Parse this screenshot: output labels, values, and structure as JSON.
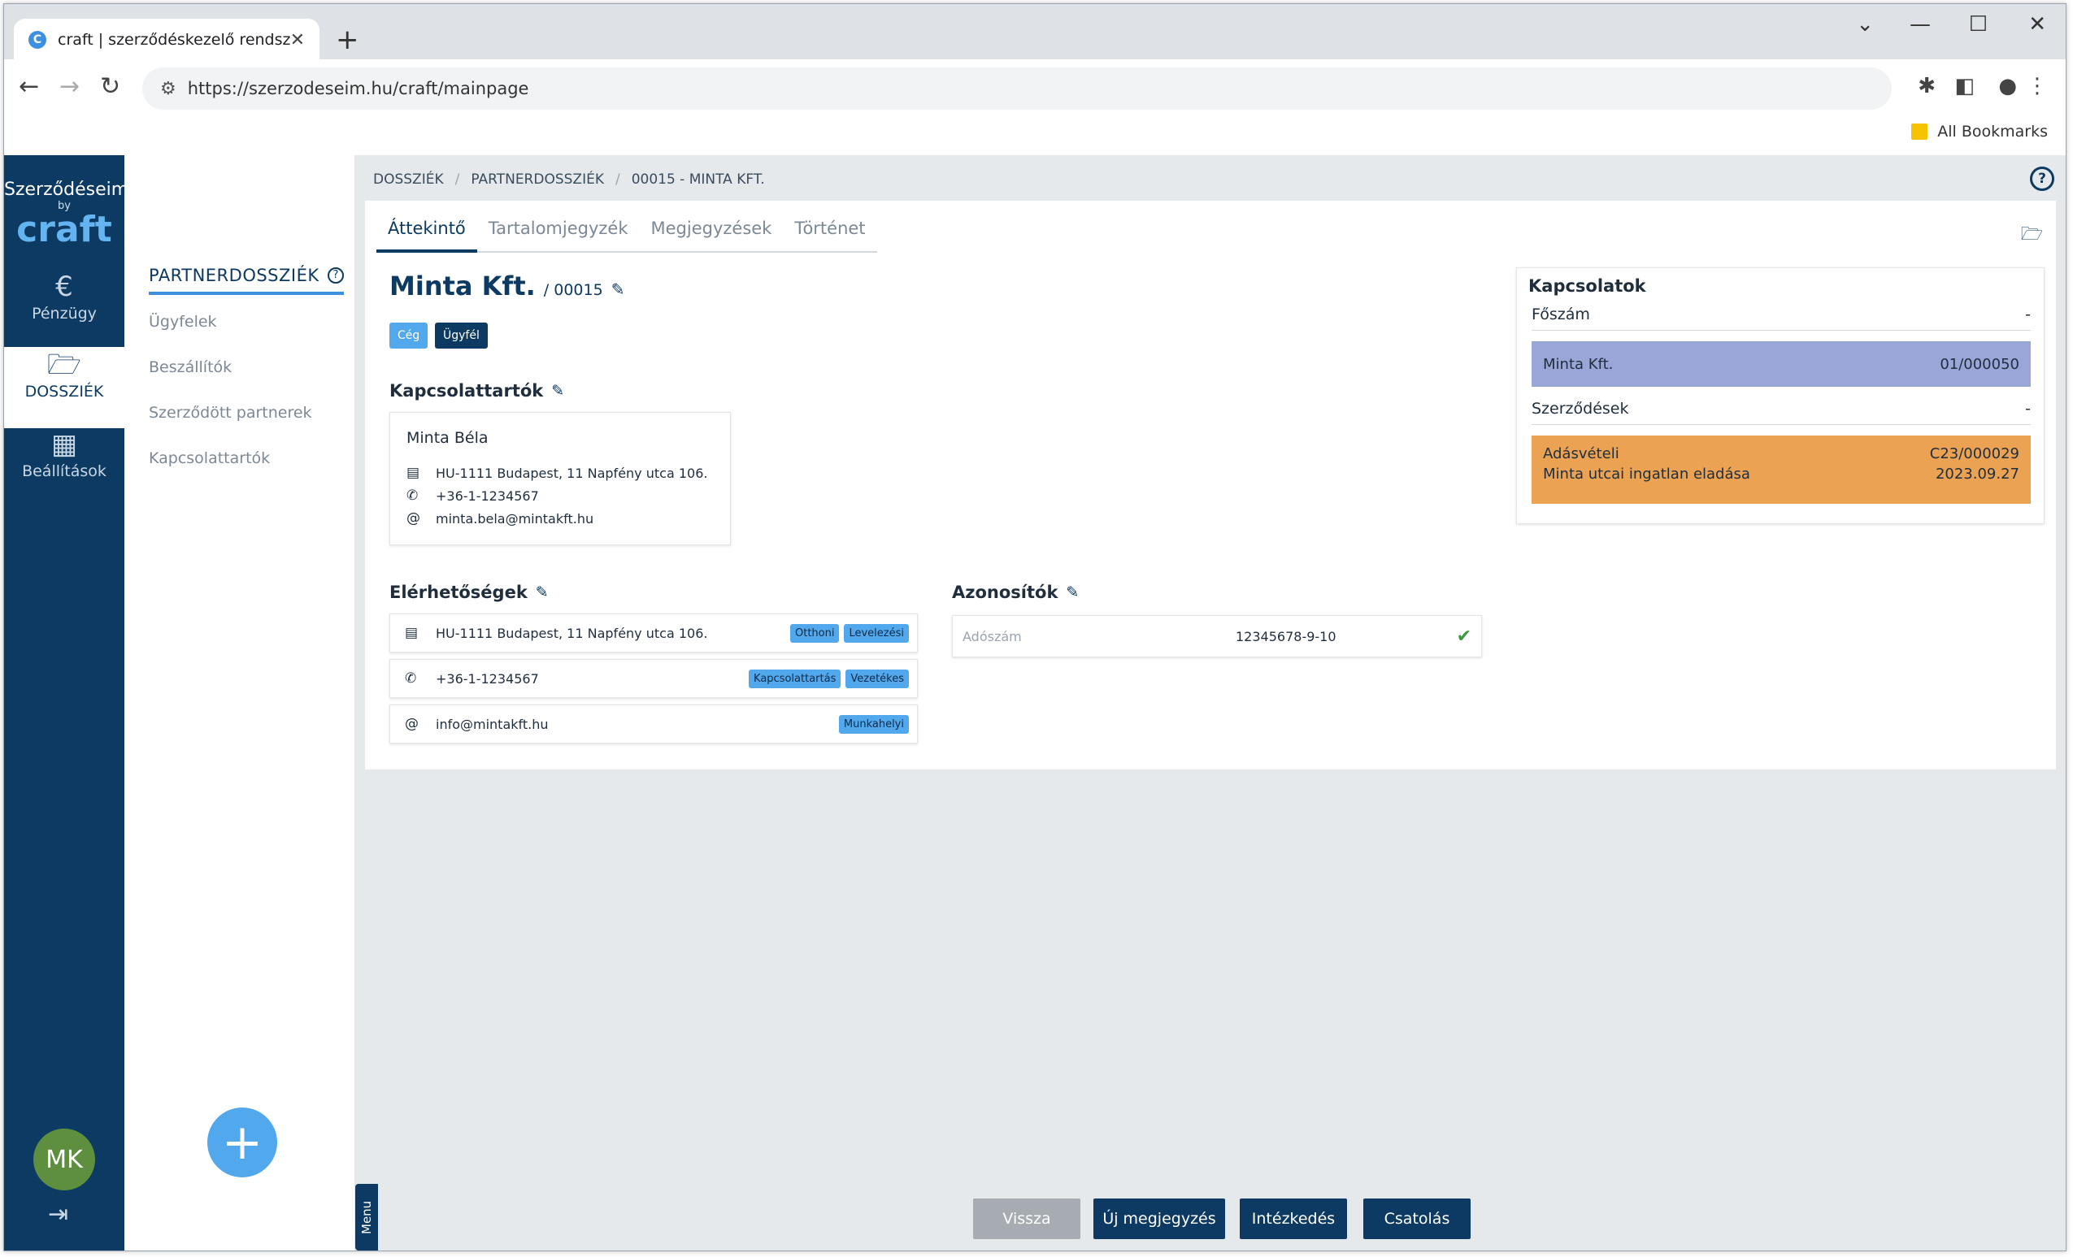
{
  "browser": {
    "tab_title": "craft | szerződéskezelő rendszer",
    "tab_favicon": "C",
    "url": "https://szerzodeseim.hu/craft/mainpage",
    "bookmarks_label": "All Bookmarks"
  },
  "brand": {
    "line1": "Szerződéseim",
    "line2": "by",
    "line3": "craft"
  },
  "rail": {
    "items": [
      {
        "label": "Pénzügy",
        "icon": "euro-icon"
      },
      {
        "label": "DOSSZIÉK",
        "icon": "folder-open-icon"
      },
      {
        "label": "Beállítások",
        "icon": "building-icon"
      }
    ],
    "avatar_initials": "MK"
  },
  "sub": {
    "title": "PARTNERDOSSZIÉK",
    "items": [
      "Ügyfelek",
      "Beszállítók",
      "Szerződött partnerek",
      "Kapcsolattartók"
    ]
  },
  "breadcrumb": [
    "DOSSZIÉK",
    "PARTNERDOSSZIÉK",
    "00015 - MINTA KFT."
  ],
  "tabs": [
    "Áttekintő",
    "Tartalomjegyzék",
    "Megjegyzések",
    "Történet"
  ],
  "company": {
    "name": "Minta Kft.",
    "id": "/ 00015",
    "badges": [
      "Cég",
      "Ügyfél"
    ]
  },
  "kapcsolattartok": {
    "title": "Kapcsolattartók",
    "contact": {
      "name": "Minta Béla",
      "address": "HU-1111 Budapest, 11 Napfény utca 106.",
      "phone": "+36-1-1234567",
      "email": "minta.bela@mintakft.hu"
    }
  },
  "elerhetosegek": {
    "title": "Elérhetőségek",
    "rows": [
      {
        "text": "HU-1111 Budapest, 11 Napfény utca 106.",
        "tags": [
          "Otthoni",
          "Levelezési"
        ]
      },
      {
        "text": "+36-1-1234567",
        "tags": [
          "Kapcsolattartás",
          "Vezetékes"
        ]
      },
      {
        "text": "info@mintakft.hu",
        "tags": [
          "Munkahelyi"
        ]
      }
    ]
  },
  "azonositok": {
    "title": "Azonosítók",
    "label": "Adószám",
    "value": "12345678-9-10"
  },
  "kapcsolatok": {
    "title": "Kapcsolatok",
    "foszam_label": "Főszám",
    "foszam_value": "-",
    "foszam_block": {
      "name": "Minta Kft.",
      "number": "01/000050"
    },
    "szerzodesek_label": "Szerződések",
    "szerzodesek_value": "-",
    "contract": {
      "type": "Adásvételi",
      "number": "C23/000029",
      "description": "Minta utcai ingatlan eladása",
      "date": "2023.09.27"
    }
  },
  "actions": {
    "back": "Vissza",
    "new_note": "Új megjegyzés",
    "action": "Intézkedés",
    "attach": "Csatolás"
  },
  "menu_tab": "Menu",
  "colors": {
    "navy": "#0c3a62",
    "accent": "#52a8ec",
    "purple": "#9aa6d8",
    "orange": "#eba253"
  }
}
